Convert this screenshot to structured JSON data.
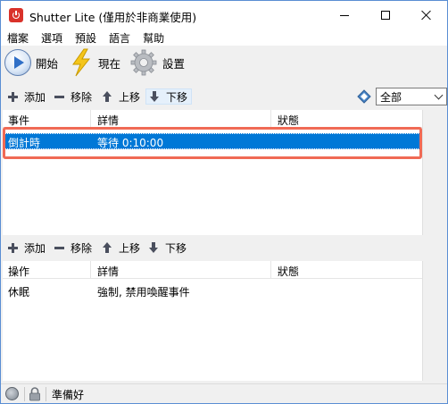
{
  "window": {
    "title": "Shutter Lite (僅用於非商業使用)",
    "controls": {
      "minimize": "minimize",
      "maximize": "maximize",
      "close": "close"
    }
  },
  "menu": [
    "檔案",
    "選項",
    "預設",
    "語言",
    "幫助"
  ],
  "toolbar": {
    "start_label": "開始",
    "now_label": "現在",
    "settings_label": "設置"
  },
  "events_panel": {
    "actions": {
      "add": "添加",
      "remove": "移除",
      "up": "上移",
      "down": "下移"
    },
    "filter_value": "全部",
    "columns": [
      "事件",
      "詳情",
      "狀態"
    ],
    "rows": [
      {
        "event": "倒計時",
        "detail": "等待 0:10:00",
        "status": "",
        "selected": true
      }
    ]
  },
  "actions_panel": {
    "actions": {
      "add": "添加",
      "remove": "移除",
      "up": "上移",
      "down": "下移"
    },
    "columns": [
      "操作",
      "詳情",
      "狀態"
    ],
    "rows": [
      {
        "action": "休眠",
        "detail": "強制, 禁用喚醒事件",
        "status": ""
      }
    ]
  },
  "status": {
    "text": "準備好"
  },
  "colors": {
    "selection": "#0078d7",
    "highlight_box": "#f06a55",
    "icon_gray": "#4a4f5e"
  }
}
